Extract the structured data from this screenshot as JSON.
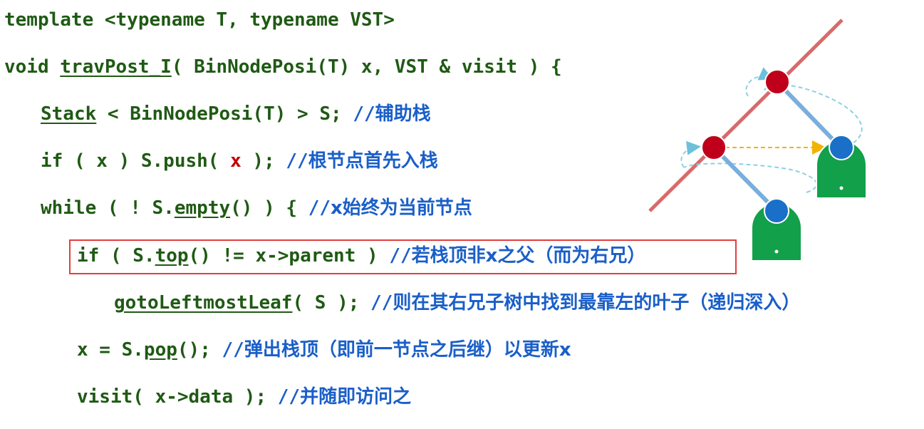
{
  "lines": [
    {
      "tokens": [
        "template <typename T, typename VST>"
      ]
    },
    {
      "pre": "void ",
      "fn": "travPost_I",
      "post": "( BinNodePosi(T) x, VST & visit ) {"
    },
    {
      "fn": "Stack",
      "post": " < BinNodePosi(T) > S; ",
      "slash": "//",
      "comment": "辅助栈"
    },
    {
      "pre": "if ( x ) S.push( ",
      "red": "x",
      "post": " ); ",
      "slash": "//",
      "comment": "根节点首先入栈"
    },
    {
      "pre": "while ( ! S.",
      "fn": "empty",
      "post": "() ) { ",
      "slash": "//",
      "comment": "x始终为当前节点"
    },
    {
      "pre": "if ( S.",
      "fn": "top",
      "post": "() != x->parent ) ",
      "slash": "//",
      "comment": "若栈顶非x之父（而为右兄）"
    },
    {
      "fn": "gotoLeftmostLeaf",
      "post": "( S ); ",
      "slash": "//",
      "comment": "则在其右兄子树中找到最靠左的叶子（递归深入）"
    },
    {
      "pre": "x = S.",
      "fn": "pop",
      "post": "(); ",
      "slash": "//",
      "comment": "弹出栈顶（即前一节点之后继）以更新x"
    },
    {
      "pre": "visit( x->data ); ",
      "slash": "//",
      "comment": "并随即访问之"
    }
  ],
  "colors": {
    "code": "#1f5a14",
    "comment": "#1a5fc8",
    "highlight": "#c00000",
    "red_node": "#c0001a",
    "blue_node": "#1a6fc8",
    "subtree": "#12a04a",
    "diagonal": "#d86a6a",
    "edge": "#7aaedc",
    "arrow": "#f0b400",
    "dashed_loop": "#8fd0e0"
  }
}
